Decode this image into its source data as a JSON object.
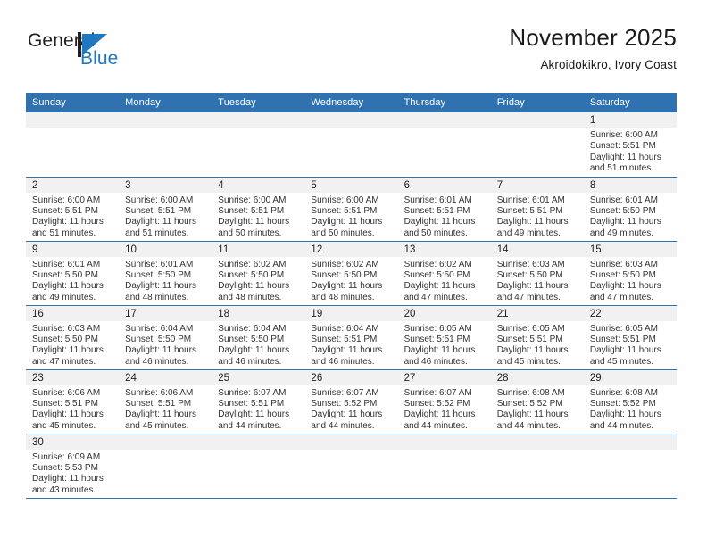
{
  "logo": {
    "word_one": "General",
    "word_two": "Blue",
    "mark": "triangle-flag-icon",
    "accent_color": "#1f78c1",
    "dark_color": "#231f20"
  },
  "header": {
    "title": "November 2025",
    "subtitle": "Akroidokikro, Ivory Coast",
    "header_bg": "#3072b0",
    "row_line_color": "#3072b0",
    "daynum_band_color": "#f1f1f1"
  },
  "weekday_headers": [
    "Sunday",
    "Monday",
    "Tuesday",
    "Wednesday",
    "Thursday",
    "Friday",
    "Saturday"
  ],
  "weeks": [
    [
      {
        "day": "",
        "empty": true,
        "lines": []
      },
      {
        "day": "",
        "empty": true,
        "lines": []
      },
      {
        "day": "",
        "empty": true,
        "lines": []
      },
      {
        "day": "",
        "empty": true,
        "lines": []
      },
      {
        "day": "",
        "empty": true,
        "lines": []
      },
      {
        "day": "",
        "empty": true,
        "lines": []
      },
      {
        "day": "1",
        "empty": false,
        "lines": [
          "Sunrise: 6:00 AM",
          "Sunset: 5:51 PM",
          "Daylight: 11 hours",
          "and 51 minutes."
        ]
      }
    ],
    [
      {
        "day": "2",
        "empty": false,
        "lines": [
          "Sunrise: 6:00 AM",
          "Sunset: 5:51 PM",
          "Daylight: 11 hours",
          "and 51 minutes."
        ]
      },
      {
        "day": "3",
        "empty": false,
        "lines": [
          "Sunrise: 6:00 AM",
          "Sunset: 5:51 PM",
          "Daylight: 11 hours",
          "and 51 minutes."
        ]
      },
      {
        "day": "4",
        "empty": false,
        "lines": [
          "Sunrise: 6:00 AM",
          "Sunset: 5:51 PM",
          "Daylight: 11 hours",
          "and 50 minutes."
        ]
      },
      {
        "day": "5",
        "empty": false,
        "lines": [
          "Sunrise: 6:00 AM",
          "Sunset: 5:51 PM",
          "Daylight: 11 hours",
          "and 50 minutes."
        ]
      },
      {
        "day": "6",
        "empty": false,
        "lines": [
          "Sunrise: 6:01 AM",
          "Sunset: 5:51 PM",
          "Daylight: 11 hours",
          "and 50 minutes."
        ]
      },
      {
        "day": "7",
        "empty": false,
        "lines": [
          "Sunrise: 6:01 AM",
          "Sunset: 5:51 PM",
          "Daylight: 11 hours",
          "and 49 minutes."
        ]
      },
      {
        "day": "8",
        "empty": false,
        "lines": [
          "Sunrise: 6:01 AM",
          "Sunset: 5:50 PM",
          "Daylight: 11 hours",
          "and 49 minutes."
        ]
      }
    ],
    [
      {
        "day": "9",
        "empty": false,
        "lines": [
          "Sunrise: 6:01 AM",
          "Sunset: 5:50 PM",
          "Daylight: 11 hours",
          "and 49 minutes."
        ]
      },
      {
        "day": "10",
        "empty": false,
        "lines": [
          "Sunrise: 6:01 AM",
          "Sunset: 5:50 PM",
          "Daylight: 11 hours",
          "and 48 minutes."
        ]
      },
      {
        "day": "11",
        "empty": false,
        "lines": [
          "Sunrise: 6:02 AM",
          "Sunset: 5:50 PM",
          "Daylight: 11 hours",
          "and 48 minutes."
        ]
      },
      {
        "day": "12",
        "empty": false,
        "lines": [
          "Sunrise: 6:02 AM",
          "Sunset: 5:50 PM",
          "Daylight: 11 hours",
          "and 48 minutes."
        ]
      },
      {
        "day": "13",
        "empty": false,
        "lines": [
          "Sunrise: 6:02 AM",
          "Sunset: 5:50 PM",
          "Daylight: 11 hours",
          "and 47 minutes."
        ]
      },
      {
        "day": "14",
        "empty": false,
        "lines": [
          "Sunrise: 6:03 AM",
          "Sunset: 5:50 PM",
          "Daylight: 11 hours",
          "and 47 minutes."
        ]
      },
      {
        "day": "15",
        "empty": false,
        "lines": [
          "Sunrise: 6:03 AM",
          "Sunset: 5:50 PM",
          "Daylight: 11 hours",
          "and 47 minutes."
        ]
      }
    ],
    [
      {
        "day": "16",
        "empty": false,
        "lines": [
          "Sunrise: 6:03 AM",
          "Sunset: 5:50 PM",
          "Daylight: 11 hours",
          "and 47 minutes."
        ]
      },
      {
        "day": "17",
        "empty": false,
        "lines": [
          "Sunrise: 6:04 AM",
          "Sunset: 5:50 PM",
          "Daylight: 11 hours",
          "and 46 minutes."
        ]
      },
      {
        "day": "18",
        "empty": false,
        "lines": [
          "Sunrise: 6:04 AM",
          "Sunset: 5:50 PM",
          "Daylight: 11 hours",
          "and 46 minutes."
        ]
      },
      {
        "day": "19",
        "empty": false,
        "lines": [
          "Sunrise: 6:04 AM",
          "Sunset: 5:51 PM",
          "Daylight: 11 hours",
          "and 46 minutes."
        ]
      },
      {
        "day": "20",
        "empty": false,
        "lines": [
          "Sunrise: 6:05 AM",
          "Sunset: 5:51 PM",
          "Daylight: 11 hours",
          "and 46 minutes."
        ]
      },
      {
        "day": "21",
        "empty": false,
        "lines": [
          "Sunrise: 6:05 AM",
          "Sunset: 5:51 PM",
          "Daylight: 11 hours",
          "and 45 minutes."
        ]
      },
      {
        "day": "22",
        "empty": false,
        "lines": [
          "Sunrise: 6:05 AM",
          "Sunset: 5:51 PM",
          "Daylight: 11 hours",
          "and 45 minutes."
        ]
      }
    ],
    [
      {
        "day": "23",
        "empty": false,
        "lines": [
          "Sunrise: 6:06 AM",
          "Sunset: 5:51 PM",
          "Daylight: 11 hours",
          "and 45 minutes."
        ]
      },
      {
        "day": "24",
        "empty": false,
        "lines": [
          "Sunrise: 6:06 AM",
          "Sunset: 5:51 PM",
          "Daylight: 11 hours",
          "and 45 minutes."
        ]
      },
      {
        "day": "25",
        "empty": false,
        "lines": [
          "Sunrise: 6:07 AM",
          "Sunset: 5:51 PM",
          "Daylight: 11 hours",
          "and 44 minutes."
        ]
      },
      {
        "day": "26",
        "empty": false,
        "lines": [
          "Sunrise: 6:07 AM",
          "Sunset: 5:52 PM",
          "Daylight: 11 hours",
          "and 44 minutes."
        ]
      },
      {
        "day": "27",
        "empty": false,
        "lines": [
          "Sunrise: 6:07 AM",
          "Sunset: 5:52 PM",
          "Daylight: 11 hours",
          "and 44 minutes."
        ]
      },
      {
        "day": "28",
        "empty": false,
        "lines": [
          "Sunrise: 6:08 AM",
          "Sunset: 5:52 PM",
          "Daylight: 11 hours",
          "and 44 minutes."
        ]
      },
      {
        "day": "29",
        "empty": false,
        "lines": [
          "Sunrise: 6:08 AM",
          "Sunset: 5:52 PM",
          "Daylight: 11 hours",
          "and 44 minutes."
        ]
      }
    ],
    [
      {
        "day": "30",
        "empty": false,
        "lines": [
          "Sunrise: 6:09 AM",
          "Sunset: 5:53 PM",
          "Daylight: 11 hours",
          "and 43 minutes."
        ]
      },
      {
        "day": "",
        "empty": true,
        "lines": []
      },
      {
        "day": "",
        "empty": true,
        "lines": []
      },
      {
        "day": "",
        "empty": true,
        "lines": []
      },
      {
        "day": "",
        "empty": true,
        "lines": []
      },
      {
        "day": "",
        "empty": true,
        "lines": []
      },
      {
        "day": "",
        "empty": true,
        "lines": []
      }
    ]
  ]
}
